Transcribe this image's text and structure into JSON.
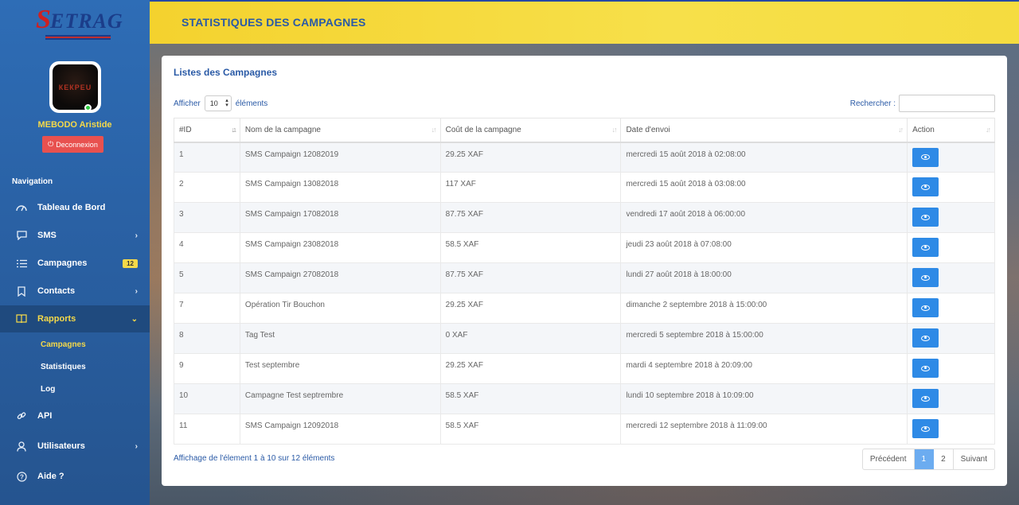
{
  "brand": {
    "logo_text": "ETRAG"
  },
  "user": {
    "name": "MEBODO Aristide",
    "avatar_text": "КЕКРЕU",
    "logout_label": "Deconnexion"
  },
  "nav": {
    "heading": "Navigation",
    "items": [
      {
        "label": "Tableau de Bord",
        "icon": "dashboard-icon"
      },
      {
        "label": "SMS",
        "icon": "chat-icon"
      },
      {
        "label": "Campagnes",
        "icon": "list-icon",
        "badge": "12"
      },
      {
        "label": "Contacts",
        "icon": "bookmark-icon"
      },
      {
        "label": "Rapports",
        "icon": "book-icon"
      },
      {
        "label": "API",
        "icon": "link-icon"
      },
      {
        "label": "Utilisateurs",
        "icon": "user-icon"
      },
      {
        "label": "Aide ?",
        "icon": "help-icon"
      }
    ],
    "sub_items": [
      "Campagnes",
      "Statistiques",
      "Log"
    ]
  },
  "header": {
    "title": "STATISTIQUES DES CAMPAGNES"
  },
  "panel": {
    "title": "Listes des Campagnes",
    "length_prefix": "Afficher",
    "length_value": "10",
    "length_suffix": "éléments",
    "search_label": "Rechercher :",
    "search_value": ""
  },
  "table": {
    "headers": [
      "#ID",
      "Nom de la campagne",
      "Coût de la campagne",
      "Date d'envoi",
      "Action"
    ],
    "rows": [
      [
        "1",
        "SMS Campaign 12082019",
        "29.25 XAF",
        "mercredi 15 août 2018 à 02:08:00"
      ],
      [
        "2",
        "SMS Campaign 13082018",
        "117 XAF",
        "mercredi 15 août 2018 à 03:08:00"
      ],
      [
        "3",
        "SMS Campaign 17082018",
        "87.75 XAF",
        "vendredi 17 août 2018 à 06:00:00"
      ],
      [
        "4",
        "SMS Campaign 23082018",
        "58.5 XAF",
        "jeudi 23 août 2018 à 07:08:00"
      ],
      [
        "5",
        "SMS Campaign 27082018",
        "87.75 XAF",
        "lundi 27 août 2018 à 18:00:00"
      ],
      [
        "7",
        "Opération Tir Bouchon",
        "29.25 XAF",
        "dimanche 2 septembre 2018 à 15:00:00"
      ],
      [
        "8",
        "Tag Test",
        "0 XAF",
        "mercredi 5 septembre 2018 à 15:00:00"
      ],
      [
        "9",
        "Test septembre",
        "29.25 XAF",
        "mardi 4 septembre 2018 à 20:09:00"
      ],
      [
        "10",
        "Campagne Test septrembre",
        "58.5 XAF",
        "lundi 10 septembre 2018 à 10:09:00"
      ],
      [
        "11",
        "SMS Campaign 12092018",
        "58.5 XAF",
        "mercredi 12 septembre 2018 à 11:09:00"
      ]
    ]
  },
  "footer": {
    "info": "Affichage de l'élement 1 à 10 sur 12 éléments",
    "prev": "Précédent",
    "pages": [
      "1",
      "2"
    ],
    "next": "Suivant"
  }
}
